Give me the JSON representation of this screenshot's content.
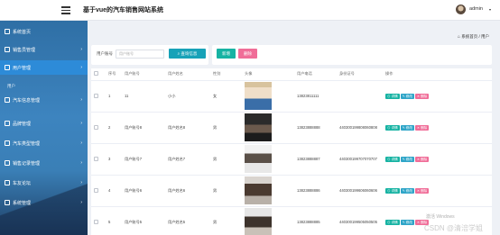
{
  "header": {
    "title": "基于vue的汽车销售网站系统",
    "user_name": "admin",
    "caret": "▾"
  },
  "sidebar": {
    "items": [
      {
        "label": "系统首页",
        "icon": "home-icon",
        "arrow": ""
      },
      {
        "label": "销售员管理",
        "icon": "grid-icon",
        "arrow": "›"
      },
      {
        "label": "用户管理",
        "icon": "grid-icon",
        "arrow": "›"
      },
      {
        "label": "汽车信息管理",
        "icon": "grid-icon",
        "arrow": "›"
      },
      {
        "label": "品牌管理",
        "icon": "grid-icon",
        "arrow": "›"
      },
      {
        "label": "汽车类型管理",
        "icon": "grid-icon",
        "arrow": "›"
      },
      {
        "label": "销售记录管理",
        "icon": "grid-icon",
        "arrow": "›"
      },
      {
        "label": "车友论坛",
        "icon": "grid-icon",
        "arrow": "›"
      },
      {
        "label": "系统管理",
        "icon": "user-icon",
        "arrow": "›"
      }
    ],
    "submenu": "用户"
  },
  "breadcrumb": {
    "home": "系统首页",
    "separator": "/",
    "current": "用户"
  },
  "search": {
    "label": "用户账号",
    "placeholder": "用户账号",
    "button": "查询信息"
  },
  "toolbar": {
    "add": "新增",
    "delete": "删除"
  },
  "table": {
    "columns": [
      "",
      "序号",
      "用户账号",
      "用户姓名",
      "性别",
      "头像",
      "用户电话",
      "身份证号",
      "操作"
    ],
    "rows": [
      {
        "index": "1",
        "account": "11",
        "name": "小小",
        "gender": "女",
        "phone": "13823811111",
        "id_number": ""
      },
      {
        "index": "2",
        "account": "用户账号8",
        "name": "用户姓名8",
        "gender": "男",
        "phone": "13823888888",
        "id_number": "440300199808060808"
      },
      {
        "index": "3",
        "account": "用户账号7",
        "name": "用户姓名7",
        "gender": "男",
        "phone": "13823888887",
        "id_number": "440300199707070707"
      },
      {
        "index": "4",
        "account": "用户账号6",
        "name": "用户姓名6",
        "gender": "男",
        "phone": "13823888886",
        "id_number": "440300199606060606"
      },
      {
        "index": "5",
        "account": "用户账号5",
        "name": "用户姓名5",
        "gender": "男",
        "phone": "13823888885",
        "id_number": "440300199505050505"
      }
    ],
    "actions": {
      "detail": "详情",
      "edit": "修改",
      "delete": "删除"
    }
  },
  "watermark": {
    "line1": "激活 Windows",
    "line2": "CSDN @清涪学姐"
  }
}
